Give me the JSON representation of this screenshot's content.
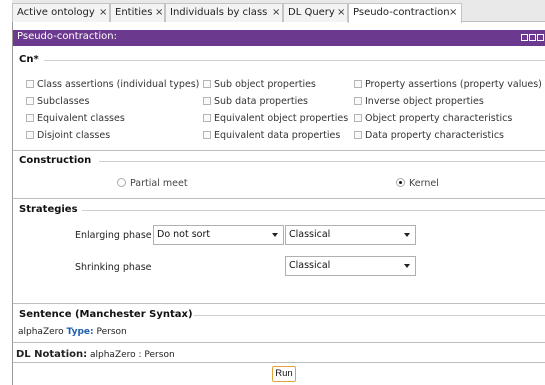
{
  "tabs": [
    {
      "label": "Active ontology",
      "close": "×"
    },
    {
      "label": "Entities",
      "close": "×"
    },
    {
      "label": "Individuals by class",
      "close": "×"
    },
    {
      "label": "DL Query",
      "close": "×"
    },
    {
      "label": "Pseudo-contraction",
      "close": "×"
    }
  ],
  "panel": {
    "title": "Pseudo-contraction:",
    "accent_color": "#6b3a8f"
  },
  "cn": {
    "heading": "Cn*",
    "checkboxes": [
      {
        "label": "Class assertions (individual types)",
        "checked": false
      },
      {
        "label": "Sub object properties",
        "checked": false
      },
      {
        "label": "Property assertions (property values)",
        "checked": false
      },
      {
        "label": "Subclasses",
        "checked": false
      },
      {
        "label": "Sub data properties",
        "checked": false
      },
      {
        "label": "Inverse object properties",
        "checked": false
      },
      {
        "label": "Equivalent classes",
        "checked": false
      },
      {
        "label": "Equivalent object properties",
        "checked": false
      },
      {
        "label": "Object property characteristics",
        "checked": false
      },
      {
        "label": "Disjoint classes",
        "checked": false
      },
      {
        "label": "Equivalent data properties",
        "checked": false
      },
      {
        "label": "Data property characteristics",
        "checked": false
      }
    ]
  },
  "construction": {
    "heading": "Construction",
    "options": [
      {
        "label": "Partial meet",
        "selected": false
      },
      {
        "label": "Kernel",
        "selected": true
      }
    ]
  },
  "strategies": {
    "heading": "Strategies",
    "enlarging": {
      "label": "Enlarging phase",
      "sort": "Do not sort",
      "method": "Classical"
    },
    "shrinking": {
      "label": "Shrinking phase",
      "method": "Classical"
    }
  },
  "sentence": {
    "heading": "Sentence (Manchester Syntax)",
    "subject": "alphaZero",
    "keyword": "Type:",
    "object": "Person"
  },
  "dl": {
    "label": "DL Notation:",
    "value": "alphaZero : Person"
  },
  "run_label": "Run"
}
